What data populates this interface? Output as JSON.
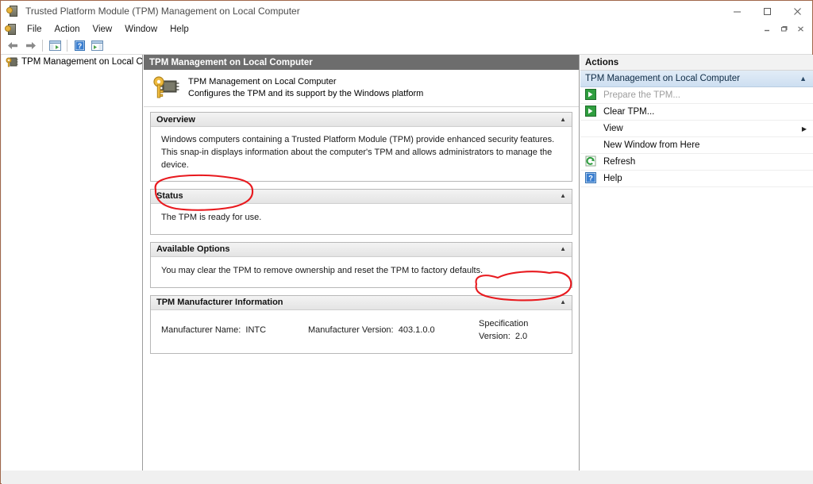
{
  "window": {
    "title": "Trusted Platform Module (TPM) Management on Local Computer",
    "icon": "tpm-chip-key-icon",
    "controls": {
      "minimize": "minimize-icon",
      "maximize": "maximize-icon",
      "close": "close-icon"
    },
    "mdi_controls": {
      "minimize": "mdi-minimize-icon",
      "restore": "mdi-restore-icon",
      "close": "mdi-close-icon"
    }
  },
  "menu": {
    "icon": "console-icon",
    "items": [
      {
        "label": "File"
      },
      {
        "label": "Action"
      },
      {
        "label": "View"
      },
      {
        "label": "Window"
      },
      {
        "label": "Help"
      }
    ]
  },
  "toolbar": {
    "buttons": [
      {
        "name": "back-icon",
        "label": "Back"
      },
      {
        "name": "forward-icon",
        "label": "Forward"
      },
      {
        "name": "show-hide-console-tree-icon",
        "label": "Show/Hide Console Tree"
      },
      {
        "name": "help-icon",
        "label": "Help"
      },
      {
        "name": "show-hide-action-pane-icon",
        "label": "Show/Hide Action Pane"
      }
    ]
  },
  "tree": {
    "item": {
      "label": "TPM Management on Local Comp",
      "icon": "tpm-key-icon"
    },
    "scrollbar": {
      "left_arrow": "scroll-left-icon",
      "right_arrow": "scroll-right-icon"
    }
  },
  "center": {
    "header": "TPM Management on Local Computer",
    "banner": {
      "icon": "tpm-key-chip-icon",
      "title": "TPM Management on Local Computer",
      "subtitle": "Configures the TPM and its support by the Windows platform"
    },
    "panels": [
      {
        "id": "overview",
        "title": "Overview",
        "collapse_icon": "collapse-chevron-icon",
        "body": "Windows computers containing a Trusted Platform Module (TPM) provide enhanced security features. This snap-in displays information about the computer's TPM and allows administrators to manage the device."
      },
      {
        "id": "status",
        "title": "Status",
        "collapse_icon": "collapse-chevron-icon",
        "body": "The TPM is ready for use."
      },
      {
        "id": "available-options",
        "title": "Available Options",
        "collapse_icon": "collapse-chevron-icon",
        "body": "You may clear the TPM to remove ownership and reset the TPM to factory defaults."
      },
      {
        "id": "tpm-manufacturer-information",
        "title": "TPM Manufacturer Information",
        "collapse_icon": "collapse-chevron-icon",
        "fields": [
          {
            "label": "Manufacturer Name:",
            "value": "INTC"
          },
          {
            "label": "Manufacturer Version:",
            "value": "403.1.0.0"
          },
          {
            "label": "Specification Version:",
            "value": "2.0"
          }
        ]
      }
    ]
  },
  "actions": {
    "header": "Actions",
    "group": {
      "title": "TPM Management on Local Computer",
      "collapse_icon": "collapse-chevron-icon"
    },
    "items": [
      {
        "label": "Prepare the TPM...",
        "icon": "green-arrow-icon",
        "disabled": true,
        "submenu": false
      },
      {
        "label": "Clear TPM...",
        "icon": "green-arrow-icon",
        "disabled": false,
        "submenu": false
      },
      {
        "label": "View",
        "icon": null,
        "disabled": false,
        "submenu": true
      },
      {
        "label": "New Window from Here",
        "icon": null,
        "disabled": false,
        "submenu": false
      },
      {
        "label": "Refresh",
        "icon": "refresh-icon",
        "disabled": false,
        "submenu": false
      },
      {
        "label": "Help",
        "icon": "help-icon",
        "disabled": false,
        "submenu": false
      }
    ]
  },
  "annotations": {
    "color": "#e8191e",
    "shapes": [
      {
        "name": "status-highlight-ellipse",
        "target": "The TPM is ready for use."
      },
      {
        "name": "specification-version-highlight-ellipse",
        "target": "Specification Version: 2.0"
      }
    ]
  }
}
